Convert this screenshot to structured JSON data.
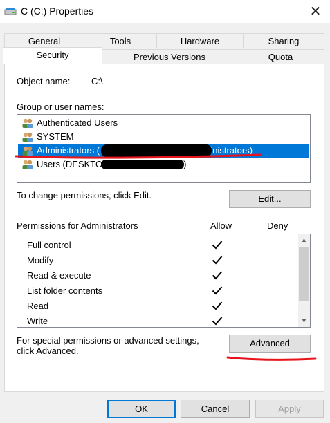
{
  "window": {
    "title": "C (C:) Properties",
    "close_glyph": "✕"
  },
  "tabs": {
    "row1": [
      "General",
      "Tools",
      "Hardware",
      "Sharing"
    ],
    "row2": [
      "Security",
      "Previous Versions",
      "Quota"
    ],
    "active": "Security"
  },
  "security": {
    "object_name_label": "Object name:",
    "object_name_value": "C:\\",
    "group_label": "Group or user names:",
    "users": [
      {
        "name": "Authenticated Users",
        "selected": false
      },
      {
        "name": "SYSTEM",
        "selected": false
      },
      {
        "name": "Administrators (",
        "suffix": "\\Administrators)",
        "selected": true
      },
      {
        "name": "Users (DESKTOP-",
        "suffix": ")",
        "selected": false
      }
    ],
    "change_text": "To change permissions, click Edit.",
    "edit_label": "Edit...",
    "permissions_label": "Permissions for Administrators",
    "allow_header": "Allow",
    "deny_header": "Deny",
    "permissions": [
      {
        "name": "Full control",
        "allow": true,
        "deny": false
      },
      {
        "name": "Modify",
        "allow": true,
        "deny": false
      },
      {
        "name": "Read & execute",
        "allow": true,
        "deny": false
      },
      {
        "name": "List folder contents",
        "allow": true,
        "deny": false
      },
      {
        "name": "Read",
        "allow": true,
        "deny": false
      },
      {
        "name": "Write",
        "allow": true,
        "deny": false
      }
    ],
    "special_text_line1": "For special permissions or advanced settings,",
    "special_text_line2": "click Advanced.",
    "advanced_label": "Advanced"
  },
  "footer": {
    "ok_label": "OK",
    "cancel_label": "Cancel",
    "apply_label": "Apply"
  },
  "colors": {
    "selection": "#0078d7",
    "annotation_red": "#e8141c"
  },
  "icons": [
    "drive-icon",
    "users-group-icon",
    "checkmark-icon",
    "scroll-up-icon",
    "scroll-down-icon"
  ]
}
